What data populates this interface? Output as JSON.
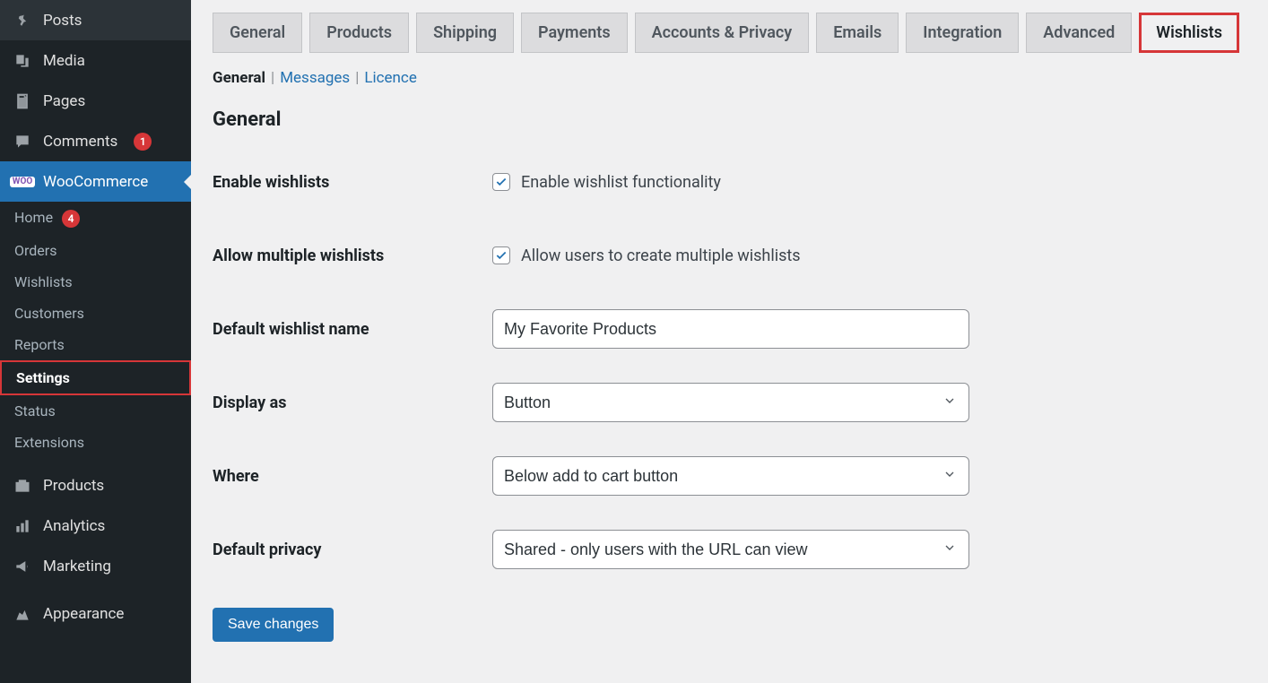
{
  "sidebar": {
    "items": [
      {
        "label": "Posts",
        "icon": "pin-icon"
      },
      {
        "label": "Media",
        "icon": "media-icon"
      },
      {
        "label": "Pages",
        "icon": "pages-icon"
      },
      {
        "label": "Comments",
        "icon": "comment-icon",
        "badge": "1"
      },
      {
        "label": "WooCommerce",
        "icon": "woo-icon",
        "active": true
      },
      {
        "label": "Products",
        "icon": "products-icon"
      },
      {
        "label": "Analytics",
        "icon": "analytics-icon"
      },
      {
        "label": "Marketing",
        "icon": "marketing-icon"
      },
      {
        "label": "Appearance",
        "icon": "appearance-icon"
      }
    ],
    "sub": [
      {
        "label": "Home",
        "badge": "4"
      },
      {
        "label": "Orders"
      },
      {
        "label": "Wishlists"
      },
      {
        "label": "Customers"
      },
      {
        "label": "Reports"
      },
      {
        "label": "Settings",
        "active": true,
        "highlight": true
      },
      {
        "label": "Status"
      },
      {
        "label": "Extensions"
      }
    ]
  },
  "tabs": [
    {
      "label": "General"
    },
    {
      "label": "Products"
    },
    {
      "label": "Shipping"
    },
    {
      "label": "Payments"
    },
    {
      "label": "Accounts & Privacy"
    },
    {
      "label": "Emails"
    },
    {
      "label": "Integration"
    },
    {
      "label": "Advanced"
    },
    {
      "label": "Wishlists",
      "active": true,
      "highlight": true
    }
  ],
  "subtabs": [
    {
      "label": "General",
      "active": true
    },
    {
      "label": "Messages"
    },
    {
      "label": "Licence"
    }
  ],
  "section_title": "General",
  "form": {
    "enable_wishlists": {
      "label": "Enable wishlists",
      "checkbox_label": "Enable wishlist functionality",
      "checked": true
    },
    "allow_multiple": {
      "label": "Allow multiple wishlists",
      "checkbox_label": "Allow users to create multiple wishlists",
      "checked": true
    },
    "default_name": {
      "label": "Default wishlist name",
      "value": "My Favorite Products"
    },
    "display_as": {
      "label": "Display as",
      "value": "Button"
    },
    "where": {
      "label": "Where",
      "value": "Below add to cart button"
    },
    "default_privacy": {
      "label": "Default privacy",
      "value": "Shared - only users with the URL can view"
    }
  },
  "buttons": {
    "save": "Save changes"
  }
}
